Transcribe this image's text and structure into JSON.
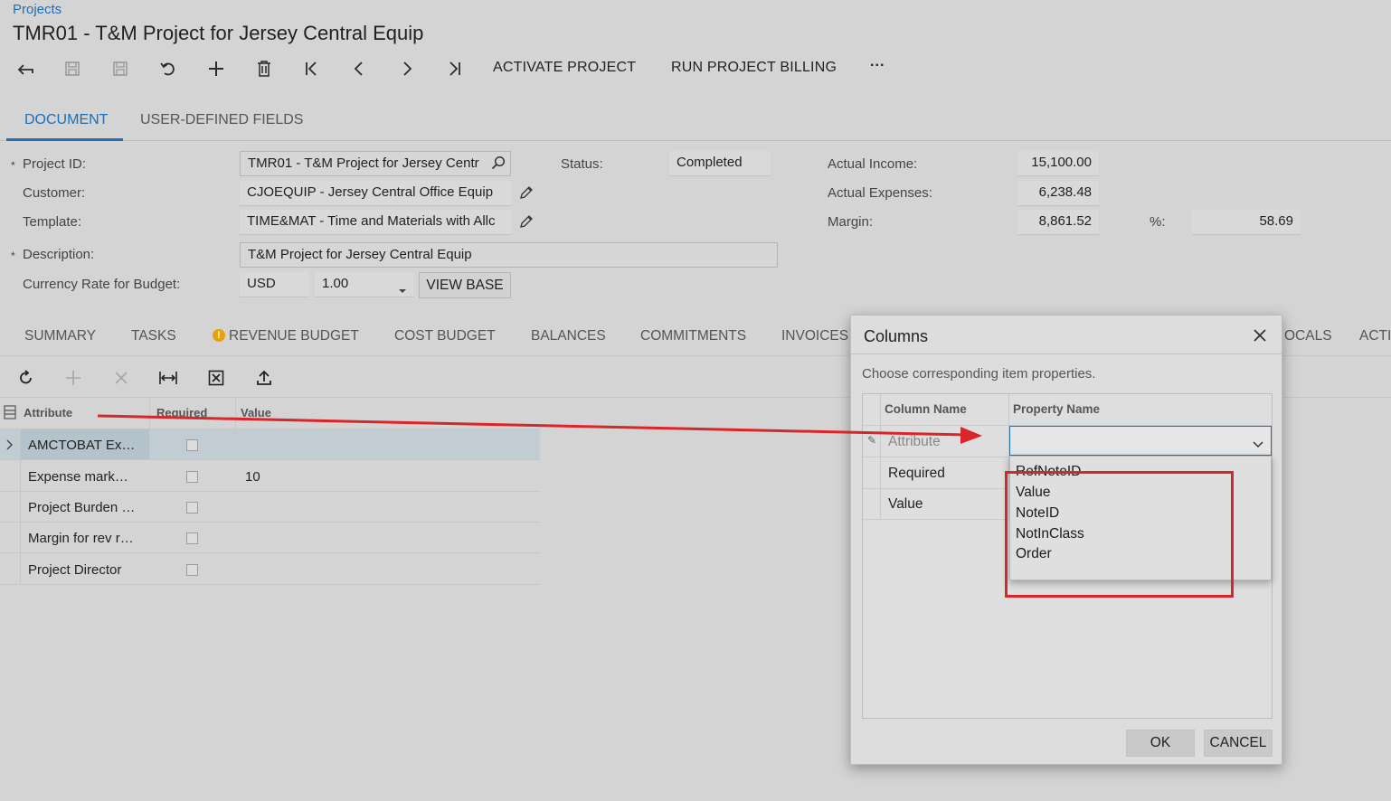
{
  "breadcrumb": "Projects",
  "page_title": "TMR01 - T&M Project for Jersey Central Equip",
  "toolbar": {
    "activate": "ACTIVATE PROJECT",
    "run_billing": "RUN PROJECT BILLING",
    "more": "···"
  },
  "tabs": [
    "DOCUMENT",
    "USER-DEFINED FIELDS"
  ],
  "form": {
    "project_id_label": "Project ID:",
    "project_id_value": "TMR01 - T&M Project for Jersey Centr",
    "customer_label": "Customer:",
    "customer_value": "CJOEQUIP - Jersey Central Office Equip",
    "template_label": "Template:",
    "template_value": "TIME&MAT - Time and Materials with Allc",
    "description_label": "Description:",
    "description_value": "T&M Project for Jersey Central Equip",
    "currency_label": "Currency Rate for Budget:",
    "currency_value": "USD",
    "rate_value": "1.00",
    "view_base": "VIEW BASE",
    "status_label": "Status:",
    "status_value": "Completed",
    "actual_income_label": "Actual Income:",
    "actual_income_value": "15,100.00",
    "actual_expenses_label": "Actual Expenses:",
    "actual_expenses_value": "6,238.48",
    "margin_label": "Margin:",
    "margin_value": "8,861.52",
    "pct_label": "%:",
    "pct_value": "58.69",
    "required_mark": "*"
  },
  "subtabs": [
    "SUMMARY",
    "TASKS",
    "REVENUE BUDGET",
    "COST BUDGET",
    "BALANCES",
    "COMMITMENTS",
    "INVOICES",
    "OCALS",
    "ACTI"
  ],
  "grid": {
    "headers": [
      "Attribute",
      "Required",
      "Value"
    ],
    "rows": [
      {
        "attribute": "AMCTOBAT Ex…",
        "value": ""
      },
      {
        "attribute": "Expense mark…",
        "value": "10"
      },
      {
        "attribute": "Project Burden …",
        "value": ""
      },
      {
        "attribute": "Margin for rev r…",
        "value": ""
      },
      {
        "attribute": "Project Director",
        "value": ""
      }
    ]
  },
  "dialog": {
    "title": "Columns",
    "subtitle": "Choose corresponding item properties.",
    "col_name_header": "Column Name",
    "prop_name_header": "Property Name",
    "rows": [
      "Attribute",
      "Required",
      "Value"
    ],
    "dropdown_options": [
      "RefNoteID",
      "Value",
      "NoteID",
      "NotInClass",
      "Order"
    ],
    "ok": "OK",
    "cancel": "CANCEL"
  },
  "colors": {
    "accent": "#1d6fb8",
    "annotation_red": "#d8262a",
    "warning": "#e8a10a"
  }
}
